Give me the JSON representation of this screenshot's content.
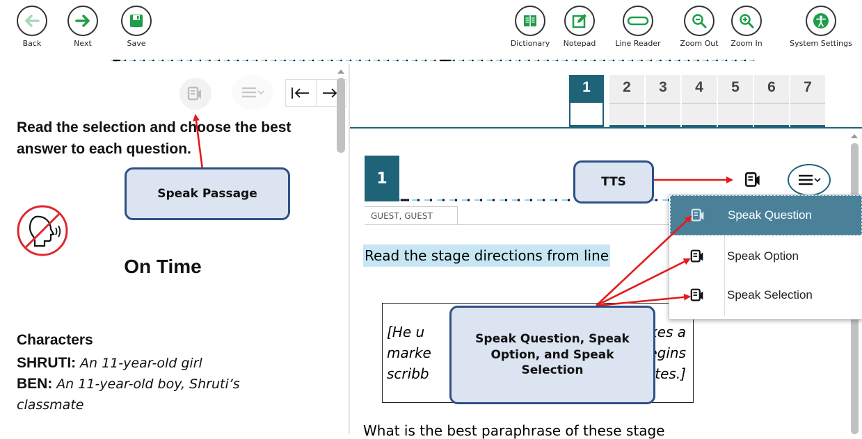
{
  "toolbar": {
    "left": [
      {
        "label": "Back",
        "icon": "arrow-left-icon",
        "color": "#a8d8b9"
      },
      {
        "label": "Next",
        "icon": "arrow-right-icon",
        "color": "#1f9d49"
      },
      {
        "label": "Save",
        "icon": "floppy-disk-icon",
        "color": "#1f9d49"
      }
    ],
    "right": [
      {
        "label": "Dictionary",
        "icon": "book-icon"
      },
      {
        "label": "Notepad",
        "icon": "pencil-square-icon"
      },
      {
        "label": "Line Reader",
        "icon": "line-reader-icon"
      },
      {
        "label": "Zoom Out",
        "icon": "zoom-out-icon"
      },
      {
        "label": "Zoom In",
        "icon": "zoom-in-icon"
      },
      {
        "label": "System Settings",
        "icon": "accessibility-icon"
      }
    ]
  },
  "passage": {
    "instructions": "Read the selection and choose the best answer to each question.",
    "title": "On Time",
    "characters_heading": "Characters",
    "characters": [
      {
        "name": "SHRUTI:",
        "desc": "An 11-year-old girl"
      },
      {
        "name": "BEN:",
        "desc": "An 11-year-old boy, Shruti’s classmate"
      }
    ]
  },
  "question": {
    "tabs": [
      "1",
      "2",
      "3",
      "4",
      "5",
      "6",
      "7"
    ],
    "active_tab": "1",
    "number": "1",
    "guest_label": "GUEST, GUEST",
    "prompt": "Read the stage directions from line",
    "excerpt_lines": [
      "[He u",
      "marke",
      "scribb"
    ],
    "excerpt_right_lines": [
      "He takes a",
      "nd begins",
      "lf as he writes.]"
    ],
    "bottom_text": "What is the best paraphrase of these stage"
  },
  "tts_menu": {
    "items": [
      "Speak Question",
      "Speak Option",
      "Speak Selection"
    ],
    "selected_color": "#4a8199"
  },
  "callouts": {
    "speak_passage": "Speak Passage",
    "tts": "TTS",
    "speak_group": "Speak Question, Speak Option, and Speak Selection"
  },
  "colors": {
    "accent": "#1f6378",
    "highlight": "#c6e6f3",
    "annotation_red": "#e41b1b",
    "callout_fill": "#dbe4f0",
    "callout_border": "#2f4f86",
    "dash_blue": "#8fd3ee"
  }
}
